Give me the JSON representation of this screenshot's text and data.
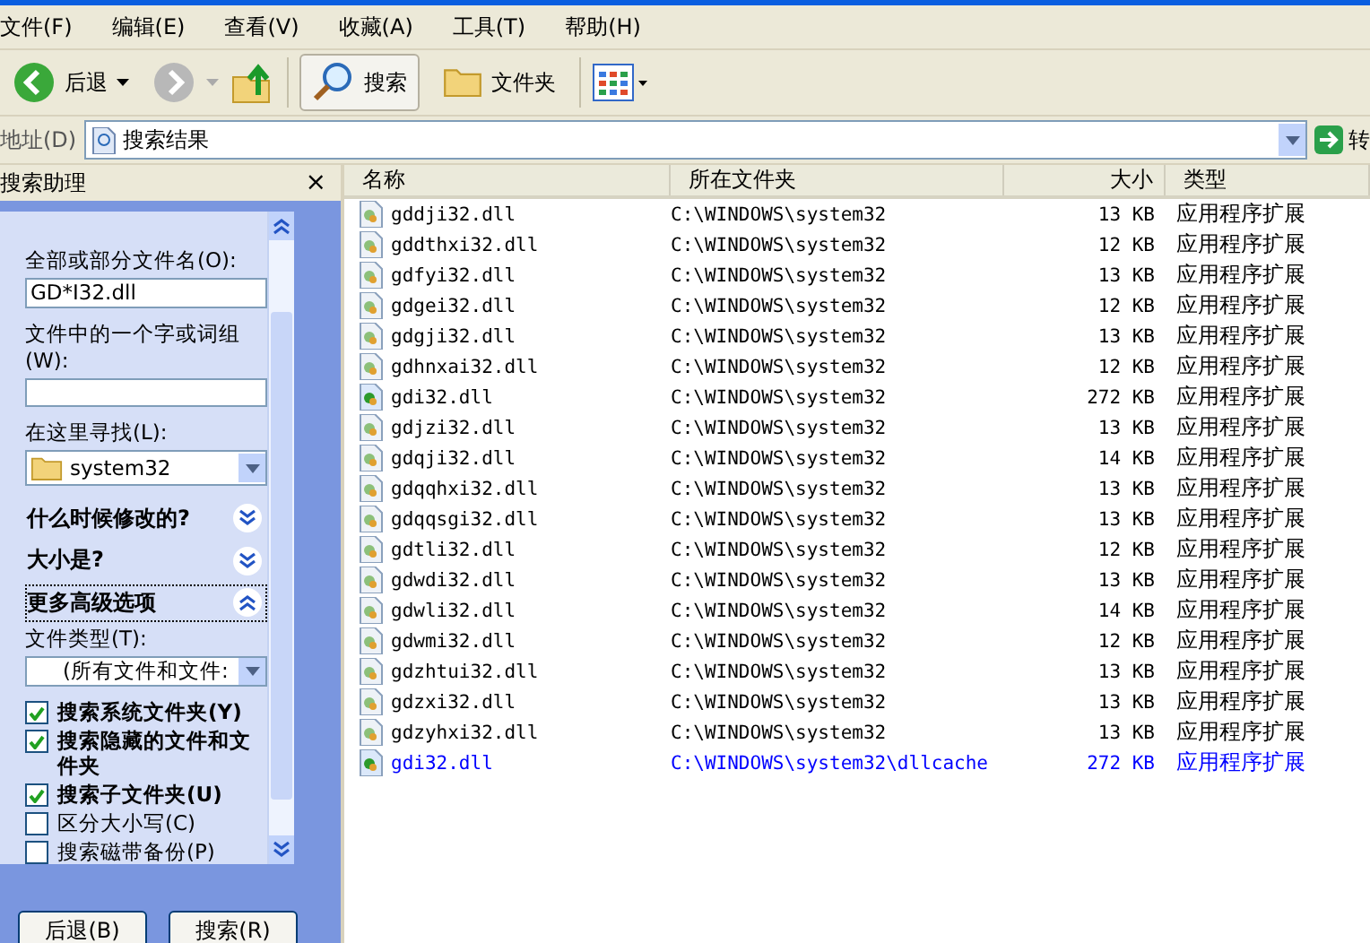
{
  "menu": [
    "文件(F)",
    "编辑(E)",
    "查看(V)",
    "收藏(A)",
    "工具(T)",
    "帮助(H)"
  ],
  "toolbar": {
    "back": "后退",
    "search": {
      "label": "搜索",
      "selected": true
    },
    "folders": {
      "label": "文件夹",
      "selected": false
    }
  },
  "address": {
    "label": "地址(D)",
    "value": "搜索结果",
    "go": "转"
  },
  "assistant": {
    "title": "搜索助理",
    "close": "×",
    "name_label": "全部或部分文件名(O):",
    "name_value": "GD*I32.dll",
    "word_label": "文件中的一个字或词组(W):",
    "look_label": "在这里寻找(L):",
    "look_value": "system32",
    "sections": [
      {
        "label": "什么时候修改的?",
        "expanded": false
      },
      {
        "label": "大小是?",
        "expanded": false
      },
      {
        "label": "更多高级选项",
        "expanded": true
      }
    ],
    "type_label": "文件类型(T):",
    "type_value": "(所有文件和文件:",
    "options": [
      {
        "label": "搜索系统文件夹(Y)",
        "checked": true,
        "bold": true
      },
      {
        "label": "搜索隐藏的文件和文件夹",
        "checked": true,
        "bold": true
      },
      {
        "label": "搜索子文件夹(U)",
        "checked": true,
        "bold": true
      },
      {
        "label": "区分大小写(C)",
        "checked": false,
        "bold": false
      },
      {
        "label": "搜索磁带备份(P)",
        "checked": false,
        "bold": false
      }
    ],
    "buttons": [
      "后退(B)",
      "搜索(R)"
    ]
  },
  "table": {
    "columns": [
      "名称",
      "所在文件夹",
      "大小",
      "类型"
    ],
    "rows": [
      {
        "name": "gddji32.dll",
        "folder": "C:\\WINDOWS\\system32",
        "size": "13 KB",
        "type": "应用程序扩展",
        "compressed": false
      },
      {
        "name": "gddthxi32.dll",
        "folder": "C:\\WINDOWS\\system32",
        "size": "12 KB",
        "type": "应用程序扩展",
        "compressed": false
      },
      {
        "name": "gdfyi32.dll",
        "folder": "C:\\WINDOWS\\system32",
        "size": "13 KB",
        "type": "应用程序扩展",
        "compressed": false
      },
      {
        "name": "gdgei32.dll",
        "folder": "C:\\WINDOWS\\system32",
        "size": "12 KB",
        "type": "应用程序扩展",
        "compressed": false
      },
      {
        "name": "gdgji32.dll",
        "folder": "C:\\WINDOWS\\system32",
        "size": "13 KB",
        "type": "应用程序扩展",
        "compressed": false
      },
      {
        "name": "gdhnxai32.dll",
        "folder": "C:\\WINDOWS\\system32",
        "size": "12 KB",
        "type": "应用程序扩展",
        "compressed": false
      },
      {
        "name": "gdi32.dll",
        "folder": "C:\\WINDOWS\\system32",
        "size": "272 KB",
        "type": "应用程序扩展",
        "compressed": false
      },
      {
        "name": "gdjzi32.dll",
        "folder": "C:\\WINDOWS\\system32",
        "size": "13 KB",
        "type": "应用程序扩展",
        "compressed": false
      },
      {
        "name": "gdqji32.dll",
        "folder": "C:\\WINDOWS\\system32",
        "size": "14 KB",
        "type": "应用程序扩展",
        "compressed": false
      },
      {
        "name": "gdqqhxi32.dll",
        "folder": "C:\\WINDOWS\\system32",
        "size": "13 KB",
        "type": "应用程序扩展",
        "compressed": false
      },
      {
        "name": "gdqqsgi32.dll",
        "folder": "C:\\WINDOWS\\system32",
        "size": "13 KB",
        "type": "应用程序扩展",
        "compressed": false
      },
      {
        "name": "gdtli32.dll",
        "folder": "C:\\WINDOWS\\system32",
        "size": "12 KB",
        "type": "应用程序扩展",
        "compressed": false
      },
      {
        "name": "gdwdi32.dll",
        "folder": "C:\\WINDOWS\\system32",
        "size": "13 KB",
        "type": "应用程序扩展",
        "compressed": false
      },
      {
        "name": "gdwli32.dll",
        "folder": "C:\\WINDOWS\\system32",
        "size": "14 KB",
        "type": "应用程序扩展",
        "compressed": false
      },
      {
        "name": "gdwmi32.dll",
        "folder": "C:\\WINDOWS\\system32",
        "size": "12 KB",
        "type": "应用程序扩展",
        "compressed": false
      },
      {
        "name": "gdzhtui32.dll",
        "folder": "C:\\WINDOWS\\system32",
        "size": "13 KB",
        "type": "应用程序扩展",
        "compressed": false
      },
      {
        "name": "gdzxi32.dll",
        "folder": "C:\\WINDOWS\\system32",
        "size": "13 KB",
        "type": "应用程序扩展",
        "compressed": false
      },
      {
        "name": "gdzyhxi32.dll",
        "folder": "C:\\WINDOWS\\system32",
        "size": "13 KB",
        "type": "应用程序扩展",
        "compressed": false
      },
      {
        "name": "gdi32.dll",
        "folder": "C:\\WINDOWS\\system32\\dllcache",
        "size": "272 KB",
        "type": "应用程序扩展",
        "compressed": true
      }
    ]
  }
}
